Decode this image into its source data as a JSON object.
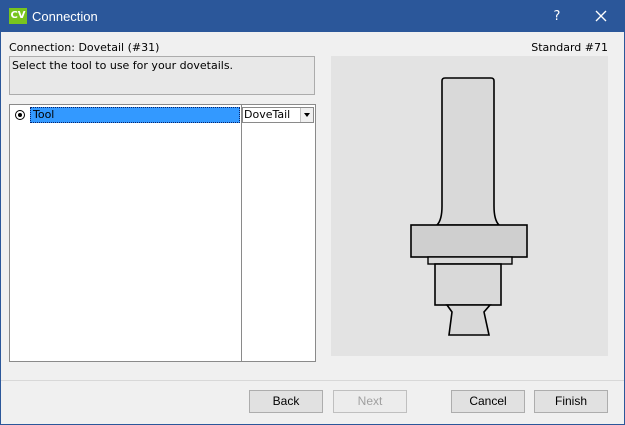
{
  "window": {
    "app_icon": "CV",
    "title": "Connection",
    "help_label": "?",
    "close_icon": "close-icon"
  },
  "header": {
    "connection_label": "Connection: Dovetail (#31)",
    "standard_label": "Standard #71"
  },
  "instruction": "Select the tool to use for your dovetails.",
  "grid": {
    "rows": [
      {
        "label": "Tool",
        "value": "DoveTail",
        "selected": true
      }
    ]
  },
  "preview": {
    "icon": "dovetail-router-bit-illustration"
  },
  "buttons": {
    "back": "Back",
    "next": "Next",
    "cancel": "Cancel",
    "finish": "Finish"
  },
  "colors": {
    "titlebar": "#2b579a",
    "app_icon": "#78c41e",
    "selection": "#3399ff"
  }
}
